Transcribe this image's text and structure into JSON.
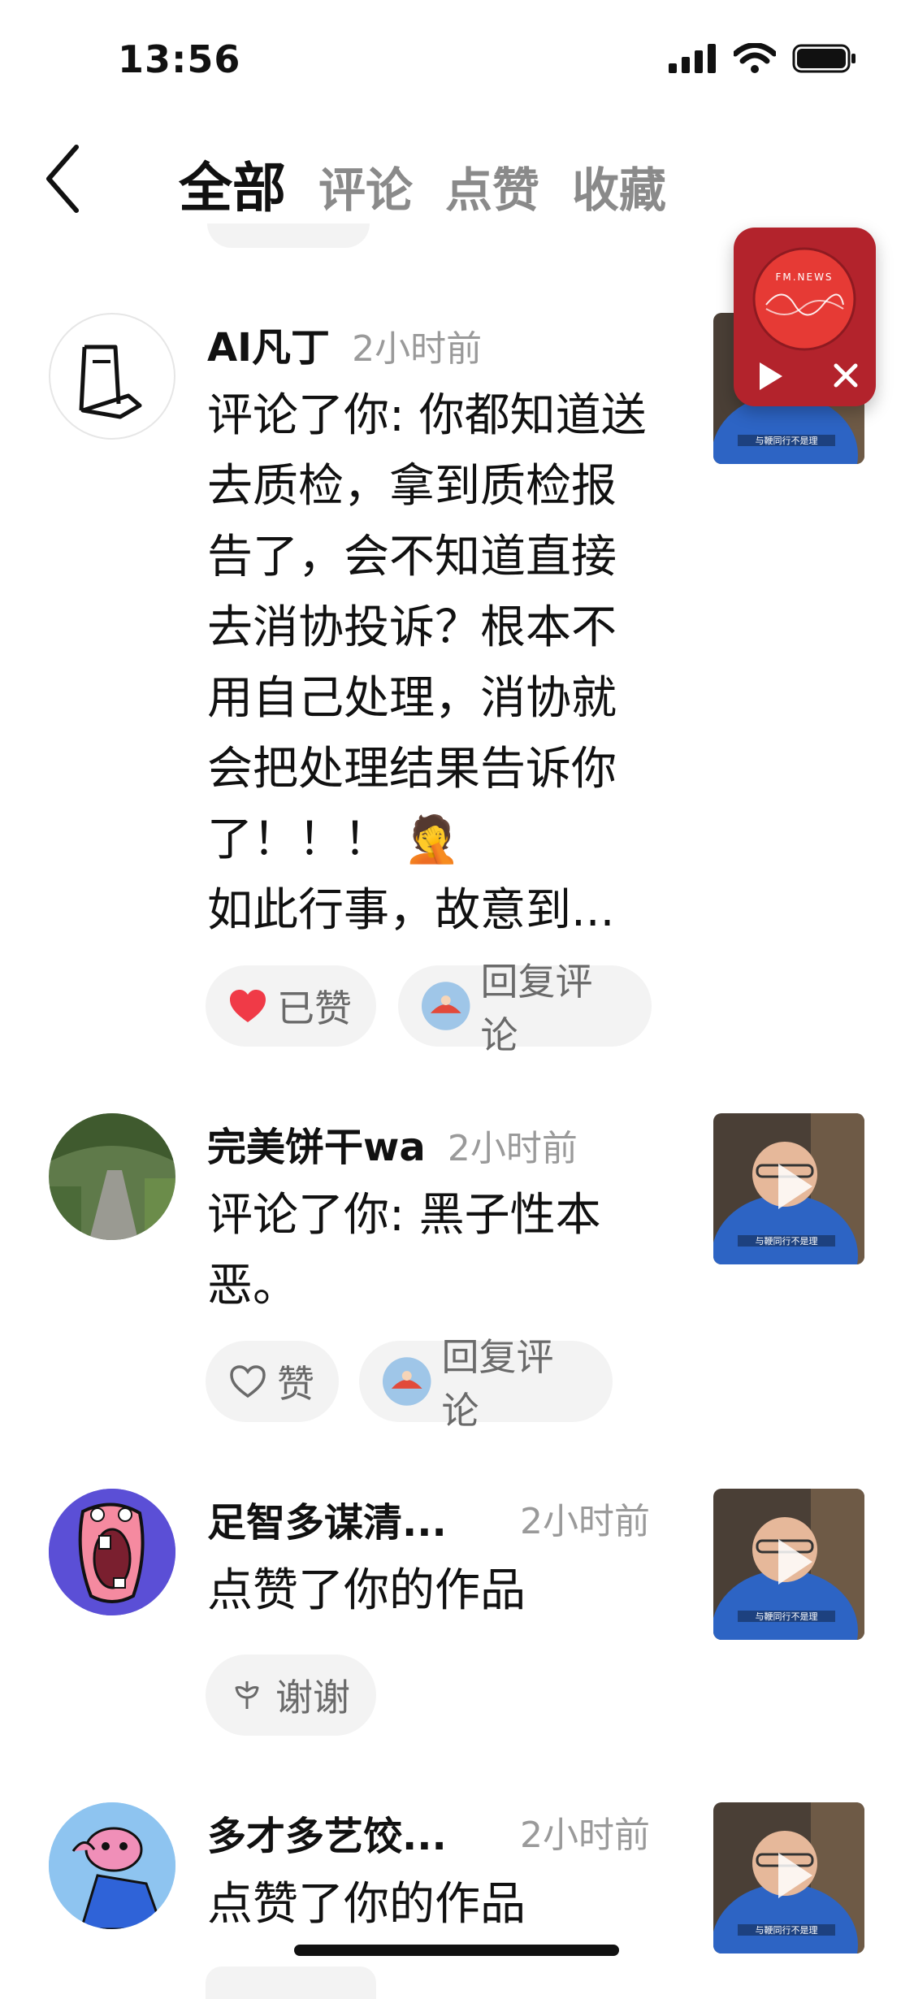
{
  "status": {
    "time": "13:56"
  },
  "tabs": [
    {
      "label": "全部",
      "active": true
    },
    {
      "label": "评论",
      "active": false
    },
    {
      "label": "点赞",
      "active": false
    },
    {
      "label": "收藏",
      "active": false
    }
  ],
  "player": {
    "label": "FM.NEWS"
  },
  "thumb_caption": "与鞭同行不是理",
  "items": [
    {
      "name": "AI凡丁",
      "time": "2小时前",
      "lines": [
        "评论了你: 你都知道送",
        "去质检，拿到质检报",
        "告了，会不知道直接",
        "去消协投诉？根本不",
        "用自己处理，消协就",
        "会把处理结果告诉你",
        "了！！！ 🤦",
        "如此行事，故意到..."
      ],
      "like_label": "已赞",
      "reply_label": "回复评论"
    },
    {
      "name": "完美饼干wa",
      "time": "2小时前",
      "lines": [
        "评论了你: 黑子性本",
        "恶。"
      ],
      "like_label": "赞",
      "reply_label": "回复评论"
    },
    {
      "name": "足智多谋清...",
      "time": "2小时前",
      "lines": [
        "点赞了你的作品"
      ],
      "thanks_label": "谢谢"
    },
    {
      "name": "多才多艺饺...",
      "time": "2小时前",
      "lines": [
        "点赞了你的作品"
      ]
    }
  ],
  "colors": {
    "liked_heart": "#f03a47",
    "player_bg": "#b3232c"
  }
}
